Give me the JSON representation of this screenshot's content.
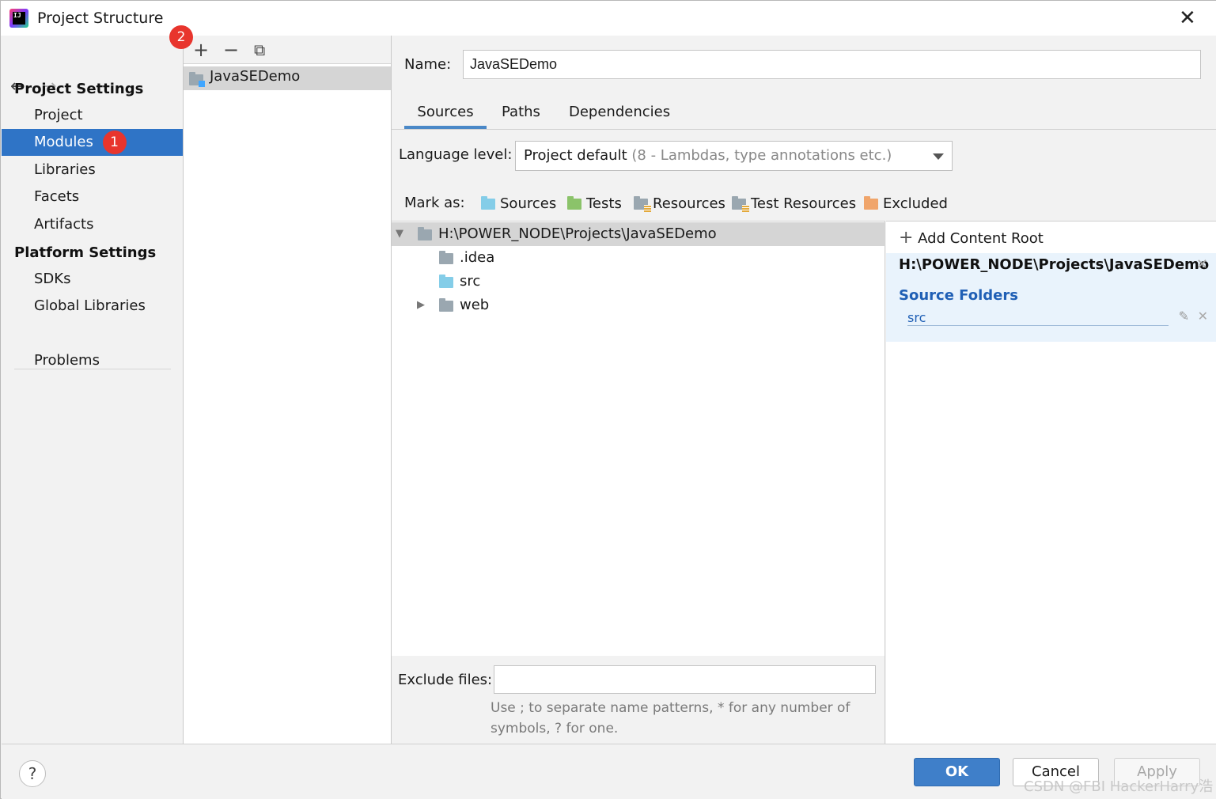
{
  "window": {
    "title": "Project Structure"
  },
  "nav": {
    "project_settings_header": "Project Settings",
    "platform_settings_header": "Platform Settings",
    "items": {
      "project": "Project",
      "modules": "Modules",
      "libraries": "Libraries",
      "facets": "Facets",
      "artifacts": "Artifacts",
      "sdks": "SDKs",
      "global_libraries": "Global Libraries",
      "problems": "Problems"
    },
    "modules_badge": "1",
    "toolbar_badge": "2"
  },
  "modules_list": {
    "items": [
      "JavaSEDemo"
    ]
  },
  "main": {
    "name_label": "Name:",
    "name_value": "JavaSEDemo",
    "tabs": [
      "Sources",
      "Paths",
      "Dependencies"
    ],
    "active_tab": "Sources",
    "language_level_label": "Language level:",
    "language_level_value": "Project default",
    "language_level_hint": "(8 - Lambdas, type annotations etc.)",
    "mark_as_label": "Mark as:",
    "mark_as": {
      "sources": "Sources",
      "tests": "Tests",
      "resources": "Resources",
      "test_resources": "Test Resources",
      "excluded": "Excluded"
    },
    "tree": {
      "root": "H:\\POWER_NODE\\Projects\\JavaSEDemo",
      "children": [
        ".idea",
        "src",
        "web"
      ]
    },
    "exclude_label": "Exclude files:",
    "exclude_value": "",
    "exclude_hint": "Use ; to separate name patterns, * for any number of symbols, ? for one."
  },
  "roots_panel": {
    "add_content_root": "Add Content Root",
    "root_path": "H:\\POWER_NODE\\Projects\\JavaSEDemo",
    "source_folders_title": "Source Folders",
    "source_folders": [
      "src"
    ]
  },
  "buttons": {
    "ok": "OK",
    "cancel": "Cancel",
    "apply": "Apply",
    "help": "?"
  },
  "watermark": "CSDN @FBI HackerHarry浩",
  "colors": {
    "selection": "#2f74c6",
    "badge": "#e8352d",
    "ok_button": "#3f7fc9",
    "source_blue": "#1f5fb5"
  }
}
